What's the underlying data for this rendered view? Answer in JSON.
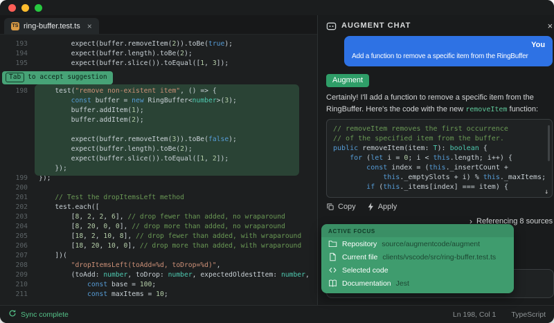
{
  "colors": {
    "accent_green": "#3f9c6e",
    "user_bubble_blue": "#2e72e4",
    "suggestion_block_green": "#2a4335",
    "hint_badge_green": "#47a377",
    "sync_green": "#55c389",
    "keyword_blue": "#569cd6",
    "comment_green": "#6a9955",
    "string_orange": "#ce9178"
  },
  "tab": {
    "icon": "TS",
    "title": "ring-buffer.test.ts",
    "close": "×"
  },
  "editor": {
    "hint": {
      "key": "Tab",
      "text": "to accept suggestion"
    },
    "lines": [
      {
        "num": "193",
        "seg": [
          [
            "p",
            "        expect(buffer.removeItem("
          ],
          [
            "n",
            "2"
          ],
          [
            "p",
            ")).toBe("
          ],
          [
            "k",
            "true"
          ],
          [
            "p",
            ");"
          ]
        ]
      },
      {
        "num": "194",
        "seg": [
          [
            "p",
            "        expect(buffer.length).toBe("
          ],
          [
            "n",
            "2"
          ],
          [
            "p",
            ");"
          ]
        ]
      },
      {
        "num": "195",
        "seg": [
          [
            "p",
            "        expect(buffer.slice()).toEqual(["
          ],
          [
            "n",
            "1"
          ],
          [
            "p",
            ", "
          ],
          [
            "n",
            "3"
          ],
          [
            "p",
            "]);"
          ]
        ]
      },
      {
        "hint": true
      },
      {
        "num": "198",
        "block": true,
        "seg": [
          [
            "p",
            "    test("
          ],
          [
            "s",
            "\"remove non-existent item\""
          ],
          [
            "p",
            ", () => {"
          ]
        ]
      },
      {
        "block": true,
        "seg": [
          [
            "p",
            "        "
          ],
          [
            "k",
            "const"
          ],
          [
            "p",
            " buffer = "
          ],
          [
            "k",
            "new"
          ],
          [
            "p",
            " RingBuffer<"
          ],
          [
            "t",
            "number"
          ],
          [
            "p",
            ">("
          ],
          [
            "n",
            "3"
          ],
          [
            "p",
            ");"
          ]
        ]
      },
      {
        "block": true,
        "seg": [
          [
            "p",
            "        buffer.addItem("
          ],
          [
            "n",
            "1"
          ],
          [
            "p",
            ");"
          ]
        ]
      },
      {
        "block": true,
        "seg": [
          [
            "p",
            "        buffer.addItem("
          ],
          [
            "n",
            "2"
          ],
          [
            "p",
            ");"
          ]
        ]
      },
      {
        "block": true,
        "seg": []
      },
      {
        "block": true,
        "seg": [
          [
            "p",
            "        expect(buffer.removeItem("
          ],
          [
            "n",
            "3"
          ],
          [
            "p",
            ")).toBe("
          ],
          [
            "k",
            "false"
          ],
          [
            "p",
            ");"
          ]
        ]
      },
      {
        "block": true,
        "seg": [
          [
            "p",
            "        expect(buffer.length).toBe("
          ],
          [
            "n",
            "2"
          ],
          [
            "p",
            ");"
          ]
        ]
      },
      {
        "block": true,
        "seg": [
          [
            "p",
            "        expect(buffer.slice()).toEqual(["
          ],
          [
            "n",
            "1"
          ],
          [
            "p",
            ", "
          ],
          [
            "n",
            "2"
          ],
          [
            "p",
            "]);"
          ]
        ]
      },
      {
        "block": true,
        "seg": [
          [
            "p",
            "    });"
          ]
        ]
      },
      {
        "num": "199",
        "seg": [
          [
            "p",
            "});"
          ]
        ]
      },
      {
        "num": "200",
        "seg": []
      },
      {
        "num": "201",
        "seg": [
          [
            "c",
            "    // Test the dropItemsLeft method"
          ]
        ]
      },
      {
        "num": "202",
        "seg": [
          [
            "p",
            "    test.each(["
          ]
        ]
      },
      {
        "num": "203",
        "seg": [
          [
            "p",
            "        ["
          ],
          [
            "n",
            "8"
          ],
          [
            "p",
            ", "
          ],
          [
            "n",
            "2"
          ],
          [
            "p",
            ", "
          ],
          [
            "n",
            "2"
          ],
          [
            "p",
            ", "
          ],
          [
            "n",
            "6"
          ],
          [
            "p",
            "], "
          ],
          [
            "c",
            "// drop fewer than added, no wraparound"
          ]
        ]
      },
      {
        "num": "204",
        "seg": [
          [
            "p",
            "        ["
          ],
          [
            "n",
            "8"
          ],
          [
            "p",
            ", "
          ],
          [
            "n",
            "20"
          ],
          [
            "p",
            ", "
          ],
          [
            "n",
            "0"
          ],
          [
            "p",
            ", "
          ],
          [
            "n",
            "0"
          ],
          [
            "p",
            "], "
          ],
          [
            "c",
            "// drop more than added, no wraparound"
          ]
        ]
      },
      {
        "num": "205",
        "seg": [
          [
            "p",
            "        ["
          ],
          [
            "n",
            "18"
          ],
          [
            "p",
            ", "
          ],
          [
            "n",
            "2"
          ],
          [
            "p",
            ", "
          ],
          [
            "n",
            "10"
          ],
          [
            "p",
            ", "
          ],
          [
            "n",
            "8"
          ],
          [
            "p",
            "], "
          ],
          [
            "c",
            "// drop fewer than added, with wraparound"
          ]
        ]
      },
      {
        "num": "206",
        "seg": [
          [
            "p",
            "        ["
          ],
          [
            "n",
            "18"
          ],
          [
            "p",
            ", "
          ],
          [
            "n",
            "20"
          ],
          [
            "p",
            ", "
          ],
          [
            "n",
            "10"
          ],
          [
            "p",
            ", "
          ],
          [
            "n",
            "0"
          ],
          [
            "p",
            "], "
          ],
          [
            "c",
            "// drop more than added, with wraparound"
          ]
        ]
      },
      {
        "num": "207",
        "seg": [
          [
            "p",
            "    ])("
          ]
        ]
      },
      {
        "num": "208",
        "seg": [
          [
            "p",
            "        "
          ],
          [
            "s",
            "\"dropItemsLeft(toAdd=%d, toDrop=%d)\""
          ],
          [
            "p",
            ","
          ]
        ]
      },
      {
        "num": "209",
        "seg": [
          [
            "p",
            "        (toAdd: "
          ],
          [
            "t",
            "number"
          ],
          [
            "p",
            ", toDrop: "
          ],
          [
            "t",
            "number"
          ],
          [
            "p",
            ", expectedOldestItem: "
          ],
          [
            "t",
            "number"
          ],
          [
            "p",
            ","
          ]
        ]
      },
      {
        "num": "210",
        "seg": [
          [
            "p",
            "            "
          ],
          [
            "k",
            "const"
          ],
          [
            "p",
            " base = "
          ],
          [
            "n",
            "100"
          ],
          [
            "p",
            ";"
          ]
        ]
      },
      {
        "num": "211",
        "seg": [
          [
            "p",
            "            "
          ],
          [
            "k",
            "const"
          ],
          [
            "p",
            " maxItems = "
          ],
          [
            "n",
            "10"
          ],
          [
            "p",
            ";"
          ]
        ]
      }
    ]
  },
  "chat": {
    "header": {
      "title": "AUGMENT CHAT",
      "close": "×"
    },
    "user": {
      "label": "You",
      "message": "Add a function to remove a specific item from the RingBuffer"
    },
    "assistant": {
      "badge": "Augment",
      "text_before": "Certainly! I'll add a function to remove a specific item from the RingBuffer. Here's the code with the new ",
      "inline_code": "removeItem",
      "text_after": " function:"
    },
    "code_lines": [
      [
        [
          "c",
          "// removeItem removes the first occurrence"
        ]
      ],
      [
        [
          "c",
          "// of the specified item from the buffer."
        ]
      ],
      [
        [
          "k",
          "public"
        ],
        [
          "p",
          " removeItem(item: "
        ],
        [
          "t",
          "T"
        ],
        [
          "p",
          "): "
        ],
        [
          "t",
          "boolean"
        ],
        [
          "p",
          " {"
        ]
      ],
      [
        [
          "p",
          "    "
        ],
        [
          "k",
          "for"
        ],
        [
          "p",
          " ("
        ],
        [
          "k",
          "let"
        ],
        [
          "p",
          " i = "
        ],
        [
          "n",
          "0"
        ],
        [
          "p",
          "; i < "
        ],
        [
          "k",
          "this"
        ],
        [
          "p",
          ".length; i++) {"
        ]
      ],
      [
        [
          "p",
          "        "
        ],
        [
          "k",
          "const"
        ],
        [
          "p",
          " index = ("
        ],
        [
          "k",
          "this"
        ],
        [
          "p",
          "._insertCount +"
        ]
      ],
      [
        [
          "p",
          "            "
        ],
        [
          "k",
          "this"
        ],
        [
          "p",
          "._emptySlots + i) % "
        ],
        [
          "k",
          "this"
        ],
        [
          "p",
          "._maxItems;"
        ]
      ],
      [
        [
          "p",
          "        "
        ],
        [
          "k",
          "if"
        ],
        [
          "p",
          " ("
        ],
        [
          "k",
          "this"
        ],
        [
          "p",
          "._items[index] === item) {"
        ]
      ]
    ],
    "scroll_down_icon": "↓",
    "actions": {
      "copy": "Copy",
      "apply": "Apply"
    },
    "referencing": {
      "chevron": "›",
      "text": "Referencing 8 sources"
    },
    "focus": {
      "header": "ACTIVE FOCUS",
      "items": [
        {
          "icon": "folder-icon",
          "label": "Repository",
          "value": "source/augmentcode/augment"
        },
        {
          "icon": "file-icon",
          "label": "Current file",
          "value": "clients/vscode/src/ring-buffer.test.ts"
        },
        {
          "icon": "code-icon",
          "label": "Selected code",
          "value": ""
        },
        {
          "icon": "book-icon",
          "label": "Documentation",
          "value": "Jest"
        }
      ]
    }
  },
  "statusbar": {
    "left": "Sync complete",
    "position": "Ln 198, Col 1",
    "language": "TypeScript"
  }
}
